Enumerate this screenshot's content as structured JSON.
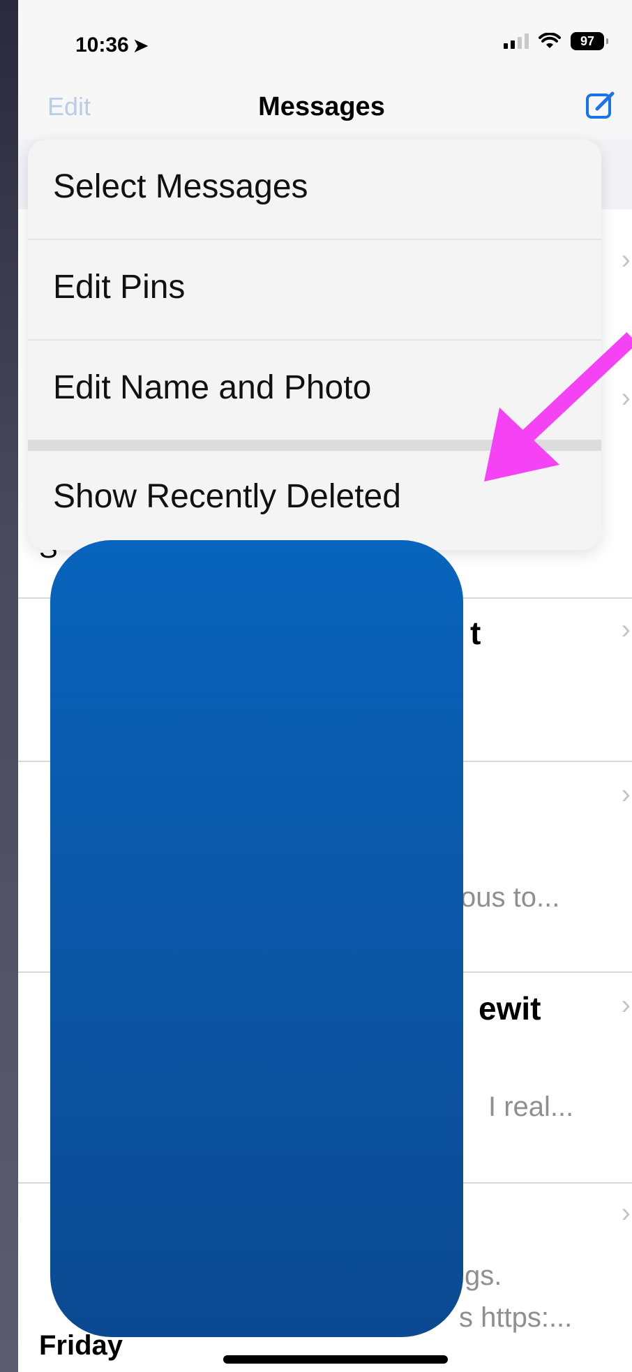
{
  "status_bar": {
    "time": "10:36",
    "battery": "97"
  },
  "nav": {
    "edit": "Edit",
    "title": "Messages"
  },
  "menu": {
    "items": [
      {
        "label": "Select Messages"
      },
      {
        "label": "Edit Pins"
      },
      {
        "label": "Edit Name and Photo"
      },
      {
        "label": "Show Recently Deleted"
      }
    ]
  },
  "list": {
    "row1_left": "S",
    "row2_title_suffix": "t",
    "row3_preview_suffix": "ous to...",
    "row4_title_suffix": "ewit",
    "row4_preview_suffix": "I real...",
    "row5_line1_suffix": "gs.",
    "row5_line2_suffix": "s https:...",
    "friday": "Friday"
  },
  "annotation": {
    "arrow_color": "#f542f5"
  },
  "redaction": {
    "color": "#0b5cb3"
  }
}
